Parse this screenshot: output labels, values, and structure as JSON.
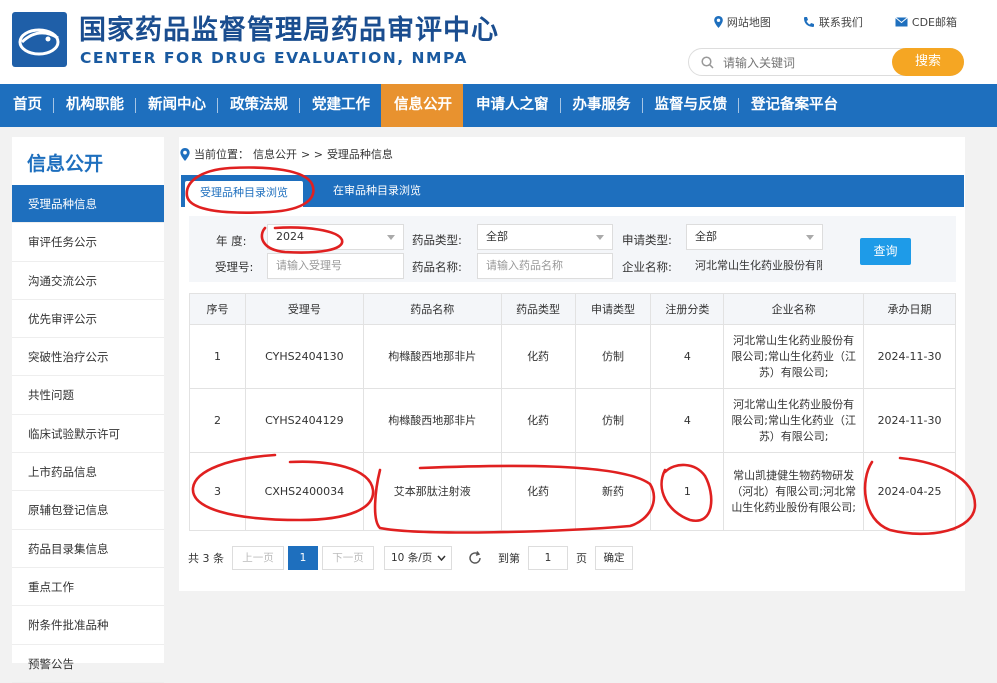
{
  "header": {
    "title_cn": "国家药品监督管理局药品审评中心",
    "title_en": "CENTER FOR DRUG EVALUATION, NMPA",
    "links": [
      "网站地图",
      "联系我们",
      "CDE邮箱"
    ],
    "search_placeholder": "请输入关键词",
    "search_button": "搜索"
  },
  "nav": [
    "首页",
    "机构职能",
    "新闻中心",
    "政策法规",
    "党建工作",
    "信息公开",
    "申请人之窗",
    "办事服务",
    "监督与反馈",
    "登记备案平台"
  ],
  "sidebar": {
    "title": "信息公开",
    "items": [
      "受理品种信息",
      "审评任务公示",
      "沟通交流公示",
      "优先审评公示",
      "突破性治疗公示",
      "共性问题",
      "临床试验默示许可",
      "上市药品信息",
      "原辅包登记信息",
      "药品目录集信息",
      "重点工作",
      "附条件批准品种",
      "预警公告"
    ]
  },
  "breadcrumb": {
    "prefix": "当前位置：",
    "path": "信息公开",
    "sep": "> >",
    "current": "受理品种信息"
  },
  "tabs": [
    "受理品种目录浏览",
    "在审品种目录浏览"
  ],
  "filter": {
    "year_label": "年    度:",
    "year_value": "2024",
    "drug_type_label": "药品类型:",
    "drug_type_value": "全部",
    "apply_type_label": "申请类型:",
    "apply_type_value": "全部",
    "accept_no_label": "受理号:",
    "accept_no_placeholder": "请输入受理号",
    "drug_name_label": "药品名称:",
    "drug_name_placeholder": "请输入药品名称",
    "company_label": "企业名称:",
    "company_value": "河北常山生化药业股份有限公司",
    "query_button": "查询"
  },
  "table": {
    "headers": [
      "序号",
      "受理号",
      "药品名称",
      "药品类型",
      "申请类型",
      "注册分类",
      "企业名称",
      "承办日期"
    ],
    "rows": [
      [
        "1",
        "CYHS2404130",
        "枸橼酸西地那非片",
        "化药",
        "仿制",
        "4",
        "河北常山生化药业股份有限公司;常山生化药业（江苏）有限公司;",
        "2024-11-30"
      ],
      [
        "2",
        "CYHS2404129",
        "枸橼酸西地那非片",
        "化药",
        "仿制",
        "4",
        "河北常山生化药业股份有限公司;常山生化药业（江苏）有限公司;",
        "2024-11-30"
      ],
      [
        "3",
        "CXHS2400034",
        "艾本那肽注射液",
        "化药",
        "新药",
        "1",
        "常山凯捷健生物药物研发（河北）有限公司;河北常山生化药业股份有限公司;",
        "2024-04-25"
      ]
    ]
  },
  "pager": {
    "total": "共 3 条",
    "prev": "上一页",
    "current": "1",
    "next": "下一页",
    "page_size": "10 条/页",
    "goto_label": "到第",
    "goto_value": "1",
    "page_unit": "页",
    "confirm": "确定"
  },
  "colors": {
    "nav_blue": "#1e6fbe",
    "nav_active_orange": "#e8922f",
    "search_orange": "#f5a623",
    "annotation_red": "#e02020"
  }
}
